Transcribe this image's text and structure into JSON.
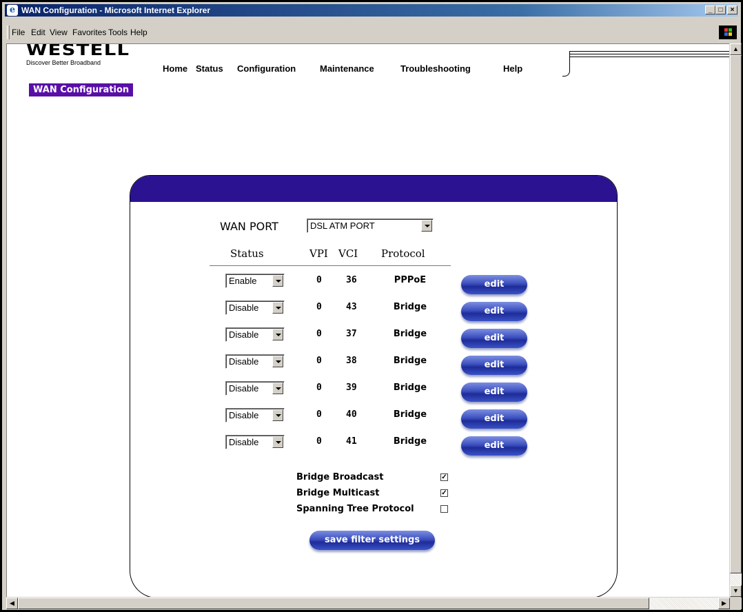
{
  "window": {
    "title": "WAN Configuration - Microsoft Internet Explorer",
    "menu": [
      "File",
      "Edit",
      "View",
      "Favorites",
      "Tools",
      "Help"
    ]
  },
  "brand": {
    "logo": "WESTELL",
    "tagline": "Discover Better Broadband"
  },
  "nav": [
    "Home",
    "Status",
    "Configuration",
    "Maintenance",
    "Troubleshooting",
    "Help"
  ],
  "section_title": "WAN Configuration",
  "wan_port": {
    "label": "WAN PORT",
    "value": "DSL ATM PORT"
  },
  "table": {
    "headers": [
      "Status",
      "VPI",
      "VCI",
      "Protocol"
    ],
    "rows": [
      {
        "status": "Enable",
        "vpi": "0",
        "vci": "36",
        "protocol": "PPPoE",
        "action": "edit"
      },
      {
        "status": "Disable",
        "vpi": "0",
        "vci": "43",
        "protocol": "Bridge",
        "action": "edit"
      },
      {
        "status": "Disable",
        "vpi": "0",
        "vci": "37",
        "protocol": "Bridge",
        "action": "edit"
      },
      {
        "status": "Disable",
        "vpi": "0",
        "vci": "38",
        "protocol": "Bridge",
        "action": "edit"
      },
      {
        "status": "Disable",
        "vpi": "0",
        "vci": "39",
        "protocol": "Bridge",
        "action": "edit"
      },
      {
        "status": "Disable",
        "vpi": "0",
        "vci": "40",
        "protocol": "Bridge",
        "action": "edit"
      },
      {
        "status": "Disable",
        "vpi": "0",
        "vci": "41",
        "protocol": "Bridge",
        "action": "edit"
      }
    ]
  },
  "options": [
    {
      "label": "Bridge Broadcast",
      "checked": true
    },
    {
      "label": "Bridge Multicast",
      "checked": true
    },
    {
      "label": "Spanning Tree Protocol",
      "checked": false
    }
  ],
  "save_button": "save filter settings",
  "colors": {
    "title_bar": "#0a246a",
    "section_badge": "#5a0ea8",
    "panel_header": "#2b1290",
    "button": "#1e2c98"
  }
}
